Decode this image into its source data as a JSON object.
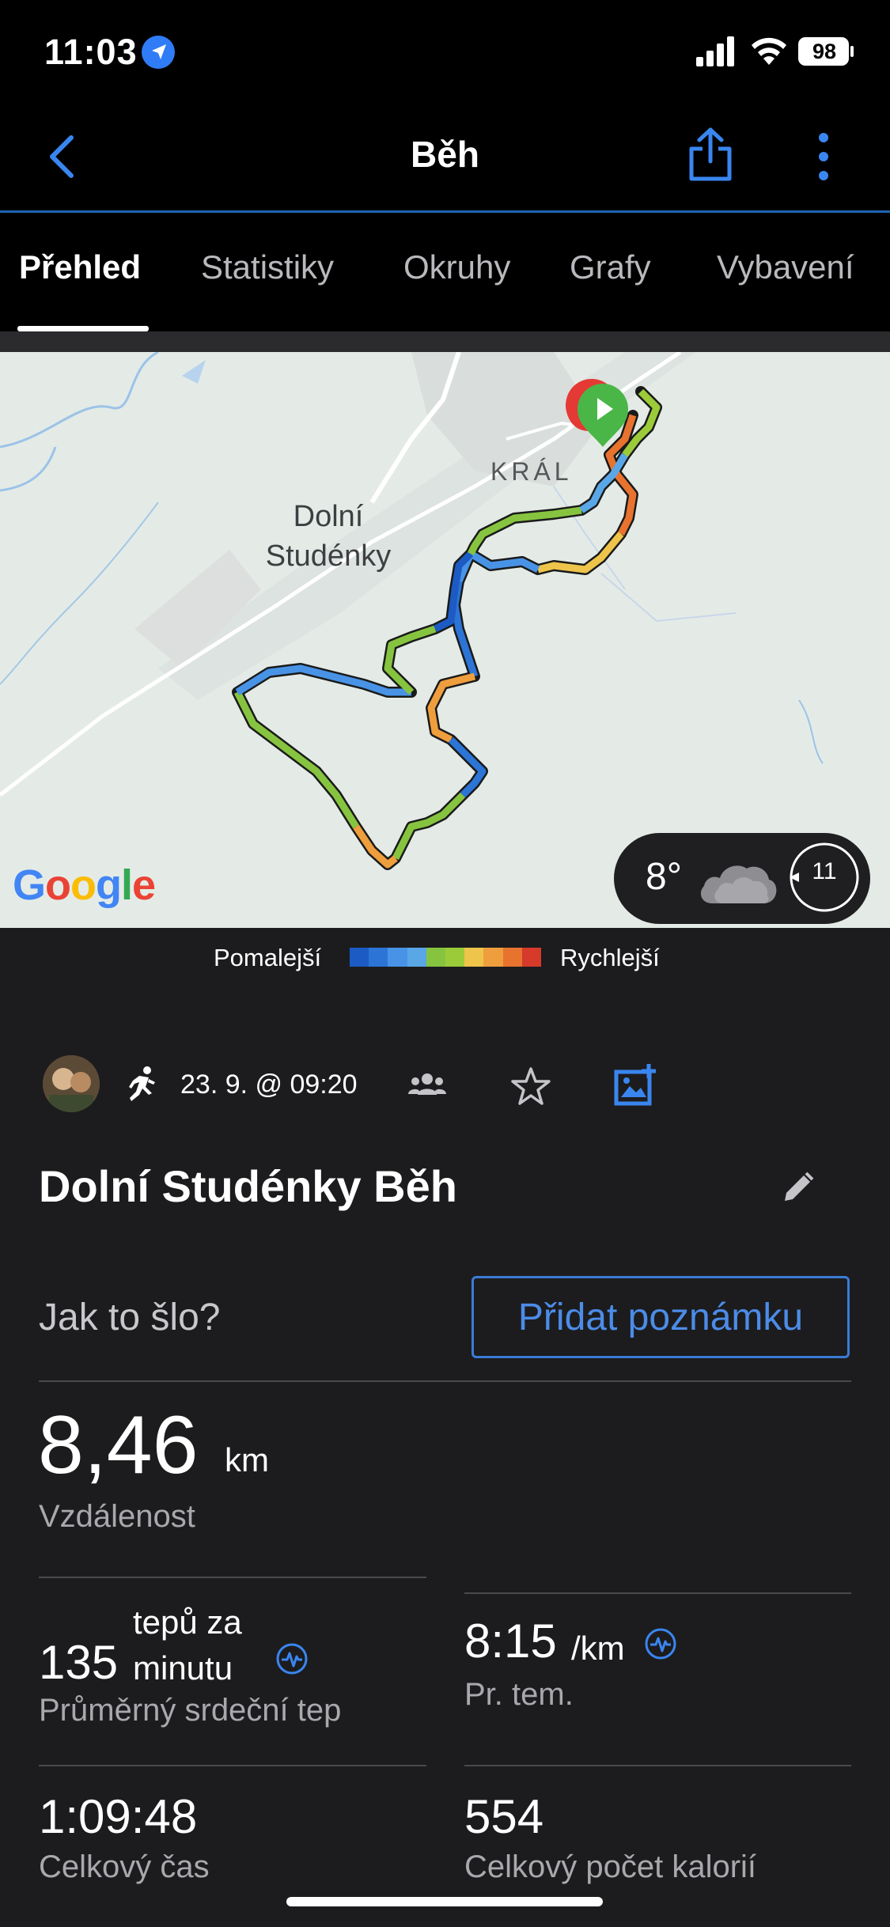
{
  "status_bar": {
    "time": "11:03",
    "battery": "98"
  },
  "header": {
    "title": "Běh"
  },
  "tabs": [
    {
      "label": "Přehled",
      "active": true
    },
    {
      "label": "Statistiky"
    },
    {
      "label": "Okruhy"
    },
    {
      "label": "Grafy"
    },
    {
      "label": "Vybavení"
    }
  ],
  "map": {
    "places": {
      "town_line1": "Dolní",
      "town_line2": "Studénky",
      "village": "KRÁL"
    },
    "attribution": "Google",
    "weather": {
      "temperature": "8°",
      "wind": "11",
      "icon": "cloud-icon"
    }
  },
  "legend": {
    "slower": "Pomalejší",
    "faster": "Rychlejší",
    "colors": [
      "#1c5bc4",
      "#2c74d6",
      "#4893e6",
      "#5aa7e8",
      "#86c440",
      "#9ccb3a",
      "#eec44a",
      "#ef9e3e",
      "#e8732f",
      "#d53a2b"
    ]
  },
  "activity": {
    "date": "23. 9. @ 09:20",
    "title": "Dolní Studénky Běh",
    "prompt": "Jak to šlo?",
    "note_button": "Přidat poznámku",
    "distance": {
      "value": "8,46",
      "unit": "km",
      "label": "Vzdálenost"
    },
    "heart_rate": {
      "value": "135",
      "unit_line1": "tepů za",
      "unit_line2": "minutu",
      "label": "Průměrný srdeční tep"
    },
    "pace": {
      "value": "8:15",
      "unit": "/km",
      "label": "Pr. tem."
    },
    "total_time": {
      "value": "1:09:48",
      "label": "Celkový čas"
    },
    "calories": {
      "value": "554",
      "label": "Celkový počet kalorií"
    }
  }
}
